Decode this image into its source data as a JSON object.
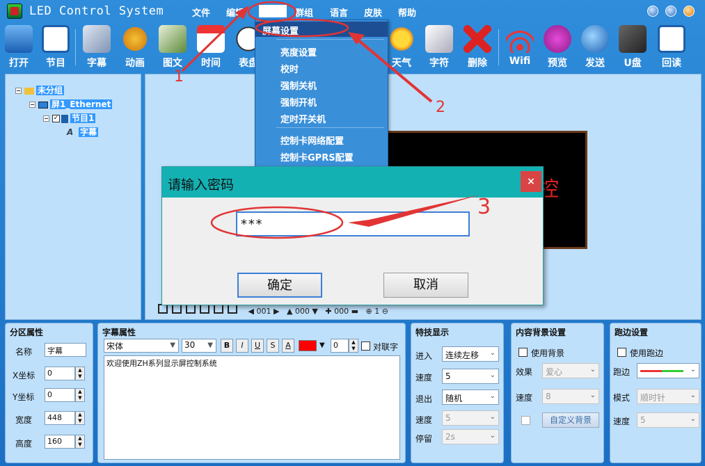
{
  "app": {
    "title": "LED Control System"
  },
  "menu": [
    "文件",
    "编辑",
    "设置",
    "群组",
    "语言",
    "皮肤",
    "帮助"
  ],
  "toolbar": [
    {
      "label": "打开",
      "icon": "folder-open-icon"
    },
    {
      "label": "节目",
      "icon": "program-icon"
    },
    {
      "label": "字幕",
      "icon": "subtitle-icon"
    },
    {
      "label": "动画",
      "icon": "animation-icon"
    },
    {
      "label": "图文",
      "icon": "image-text-icon"
    },
    {
      "label": "时间",
      "icon": "calendar-icon"
    },
    {
      "label": "表盘",
      "icon": "clock-icon"
    },
    {
      "label": "天气",
      "icon": "weather-icon"
    },
    {
      "label": "字符",
      "icon": "character-icon"
    },
    {
      "label": "删除",
      "icon": "delete-icon"
    },
    {
      "label": "Wifi",
      "icon": "wifi-icon"
    },
    {
      "label": "预览",
      "icon": "preview-icon"
    },
    {
      "label": "发送",
      "icon": "send-icon"
    },
    {
      "label": "U盘",
      "icon": "usb-icon"
    },
    {
      "label": "回读",
      "icon": "readback-icon"
    }
  ],
  "dropdown": {
    "items": [
      "屏幕设置",
      "亮度设置",
      "校时",
      "强制关机",
      "强制开机",
      "定时开关机",
      "控制卡网络配置",
      "控制卡GPRS配置"
    ]
  },
  "tree": {
    "group": "未分组",
    "screen": "屏1_Ethernet",
    "program": "节目1",
    "item": "字幕"
  },
  "canvas": {
    "preview_text": "控",
    "toolbar_values": [
      "001",
      "000",
      "000",
      "1"
    ]
  },
  "dialog": {
    "title": "请输入密码",
    "close": "×",
    "password": "***",
    "ok": "确定",
    "cancel": "取消"
  },
  "zone_props": {
    "title": "分区属性",
    "name_label": "名称",
    "name_value": "字幕",
    "x_label": "X坐标",
    "x_value": "0",
    "y_label": "Y坐标",
    "y_value": "0",
    "w_label": "宽度",
    "w_value": "448",
    "h_label": "高度",
    "h_value": "160"
  },
  "subtitle_props": {
    "title": "字幕属性",
    "font": "宋体",
    "size": "30",
    "bold": "B",
    "italic": "I",
    "underline": "U",
    "strike": "S",
    "color_btn": "A",
    "spacing": "0",
    "align_label": "对联字",
    "content": "欢迎使用ZH系列显示屏控制系统",
    "text_color": "#ff0000"
  },
  "effects": {
    "title": "特技显示",
    "enter_label": "进入",
    "enter_value": "连续左移",
    "speed1_label": "速度",
    "speed1_value": "5",
    "exit_label": "退出",
    "exit_value": "随机",
    "speed2_label": "速度",
    "speed2_value": "5",
    "stay_label": "停留",
    "stay_value": "2s"
  },
  "background": {
    "title": "内容背景设置",
    "use_label": "使用背景",
    "effect_label": "效果",
    "effect_value": "爱心",
    "speed_label": "速度",
    "speed_value": "8",
    "custom_btn": "自定义背景"
  },
  "border": {
    "title": "跑边设置",
    "use_label": "使用跑边",
    "border_label": "跑边",
    "mode_label": "模式",
    "mode_value": "顺时针",
    "speed_label": "速度",
    "speed_value": "5"
  },
  "annotations": [
    "1",
    "2",
    "3"
  ]
}
